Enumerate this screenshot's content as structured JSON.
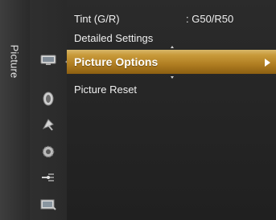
{
  "sidebar": {
    "category_label": "Picture"
  },
  "icons": [
    "picture-icon",
    "sound-icon",
    "channel-icon",
    "setup-icon",
    "input-icon",
    "application-icon"
  ],
  "menu": {
    "items": [
      {
        "label": "Tint (G/R)",
        "value": ": G50/R50"
      },
      {
        "label": "Detailed Settings"
      },
      {
        "label": "Picture Options",
        "selected": true
      },
      {
        "label": "Picture Reset"
      }
    ]
  },
  "colors": {
    "selection": "#c89a3a",
    "background": "#262626"
  }
}
